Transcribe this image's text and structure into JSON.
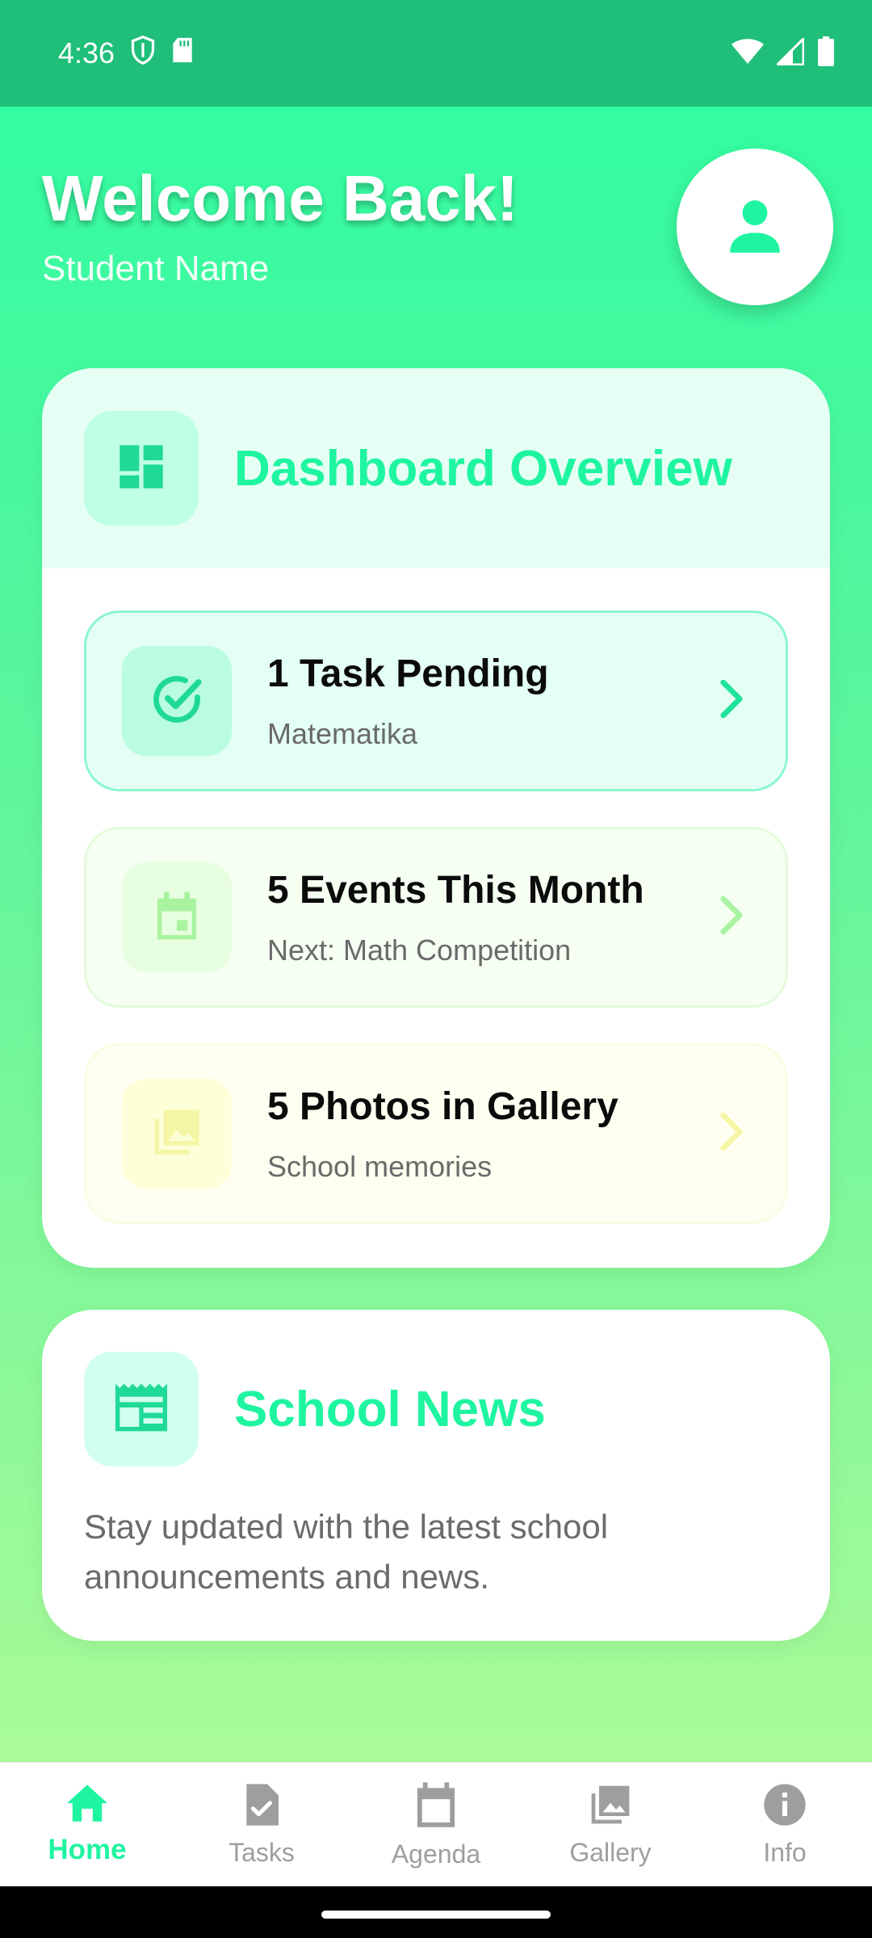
{
  "status_bar": {
    "time": "4:36"
  },
  "header": {
    "welcome": "Welcome Back!",
    "student_name": "Student Name"
  },
  "dashboard": {
    "title": "Dashboard Overview",
    "items": [
      {
        "title": "1 Task Pending",
        "subtitle": "Matematika",
        "icon": "task-check-icon",
        "color": "#1fe39a"
      },
      {
        "title": "5 Events This Month",
        "subtitle": "Next: Math Competition",
        "icon": "calendar-icon",
        "color": "#a9f3a0"
      },
      {
        "title": "5 Photos in Gallery",
        "subtitle": "School memories",
        "icon": "photo-library-icon",
        "color": "#f5f6a5"
      }
    ]
  },
  "news": {
    "title": "School News",
    "description": "Stay updated with the latest school announcements and news."
  },
  "nav": {
    "items": [
      {
        "label": "Home",
        "icon": "home-icon",
        "active": true
      },
      {
        "label": "Tasks",
        "icon": "assignment-icon",
        "active": false
      },
      {
        "label": "Agenda",
        "icon": "calendar-icon",
        "active": false
      },
      {
        "label": "Gallery",
        "icon": "photo-library-icon",
        "active": false
      },
      {
        "label": "Info",
        "icon": "info-icon",
        "active": false
      }
    ]
  },
  "colors": {
    "accent": "#1ff5a1",
    "status_bar": "#1fbf79",
    "nav_inactive": "#9e9e9e"
  }
}
